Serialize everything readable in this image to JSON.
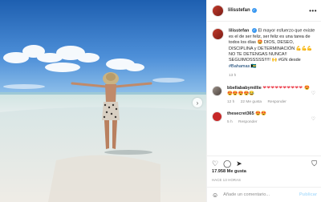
{
  "post": {
    "username": "lilisstefan",
    "verified_glyph": "✓",
    "more_glyph": "•••",
    "next_glyph": "›"
  },
  "caption": {
    "username": "lilisstefan",
    "text": "El mayor esfuerzo que existe es el de ser feliz, ser feliz es una tarea de todos los días 🤩 DIOS, DESEO, DISCIPLINA y DETERMINACIÓN 💪💪💪 NO TE DETENGAS NUNCA!! SEGUIMOSSSSS!!!!! 🙌 #GN desde",
    "hashtag": "#Bahamas",
    "trailing_emoji": "🇧🇸",
    "time": "13 h"
  },
  "comments": [
    {
      "username": "bbellababymillie",
      "hearts": "❤❤❤❤❤❤❤❤❤❤",
      "emojis": "😍😍😍😍😍😂",
      "time": "12 h",
      "likes": "22 Me gusta",
      "reply": "Responder"
    },
    {
      "username": "thesecret365",
      "emojis": "😍😍",
      "time": "5 h",
      "reply": "Responder"
    }
  ],
  "actions": {
    "like_glyph": "♡",
    "comment_glyph": "◯",
    "share_glyph": "➤",
    "save_glyph": "⛉"
  },
  "likes": "17.958 Me gusta",
  "posted_ago": "HACE 13 HORAS",
  "add_comment": {
    "emoji_glyph": "☺",
    "placeholder": "Añade un comentario...",
    "publish": "Publicar"
  }
}
